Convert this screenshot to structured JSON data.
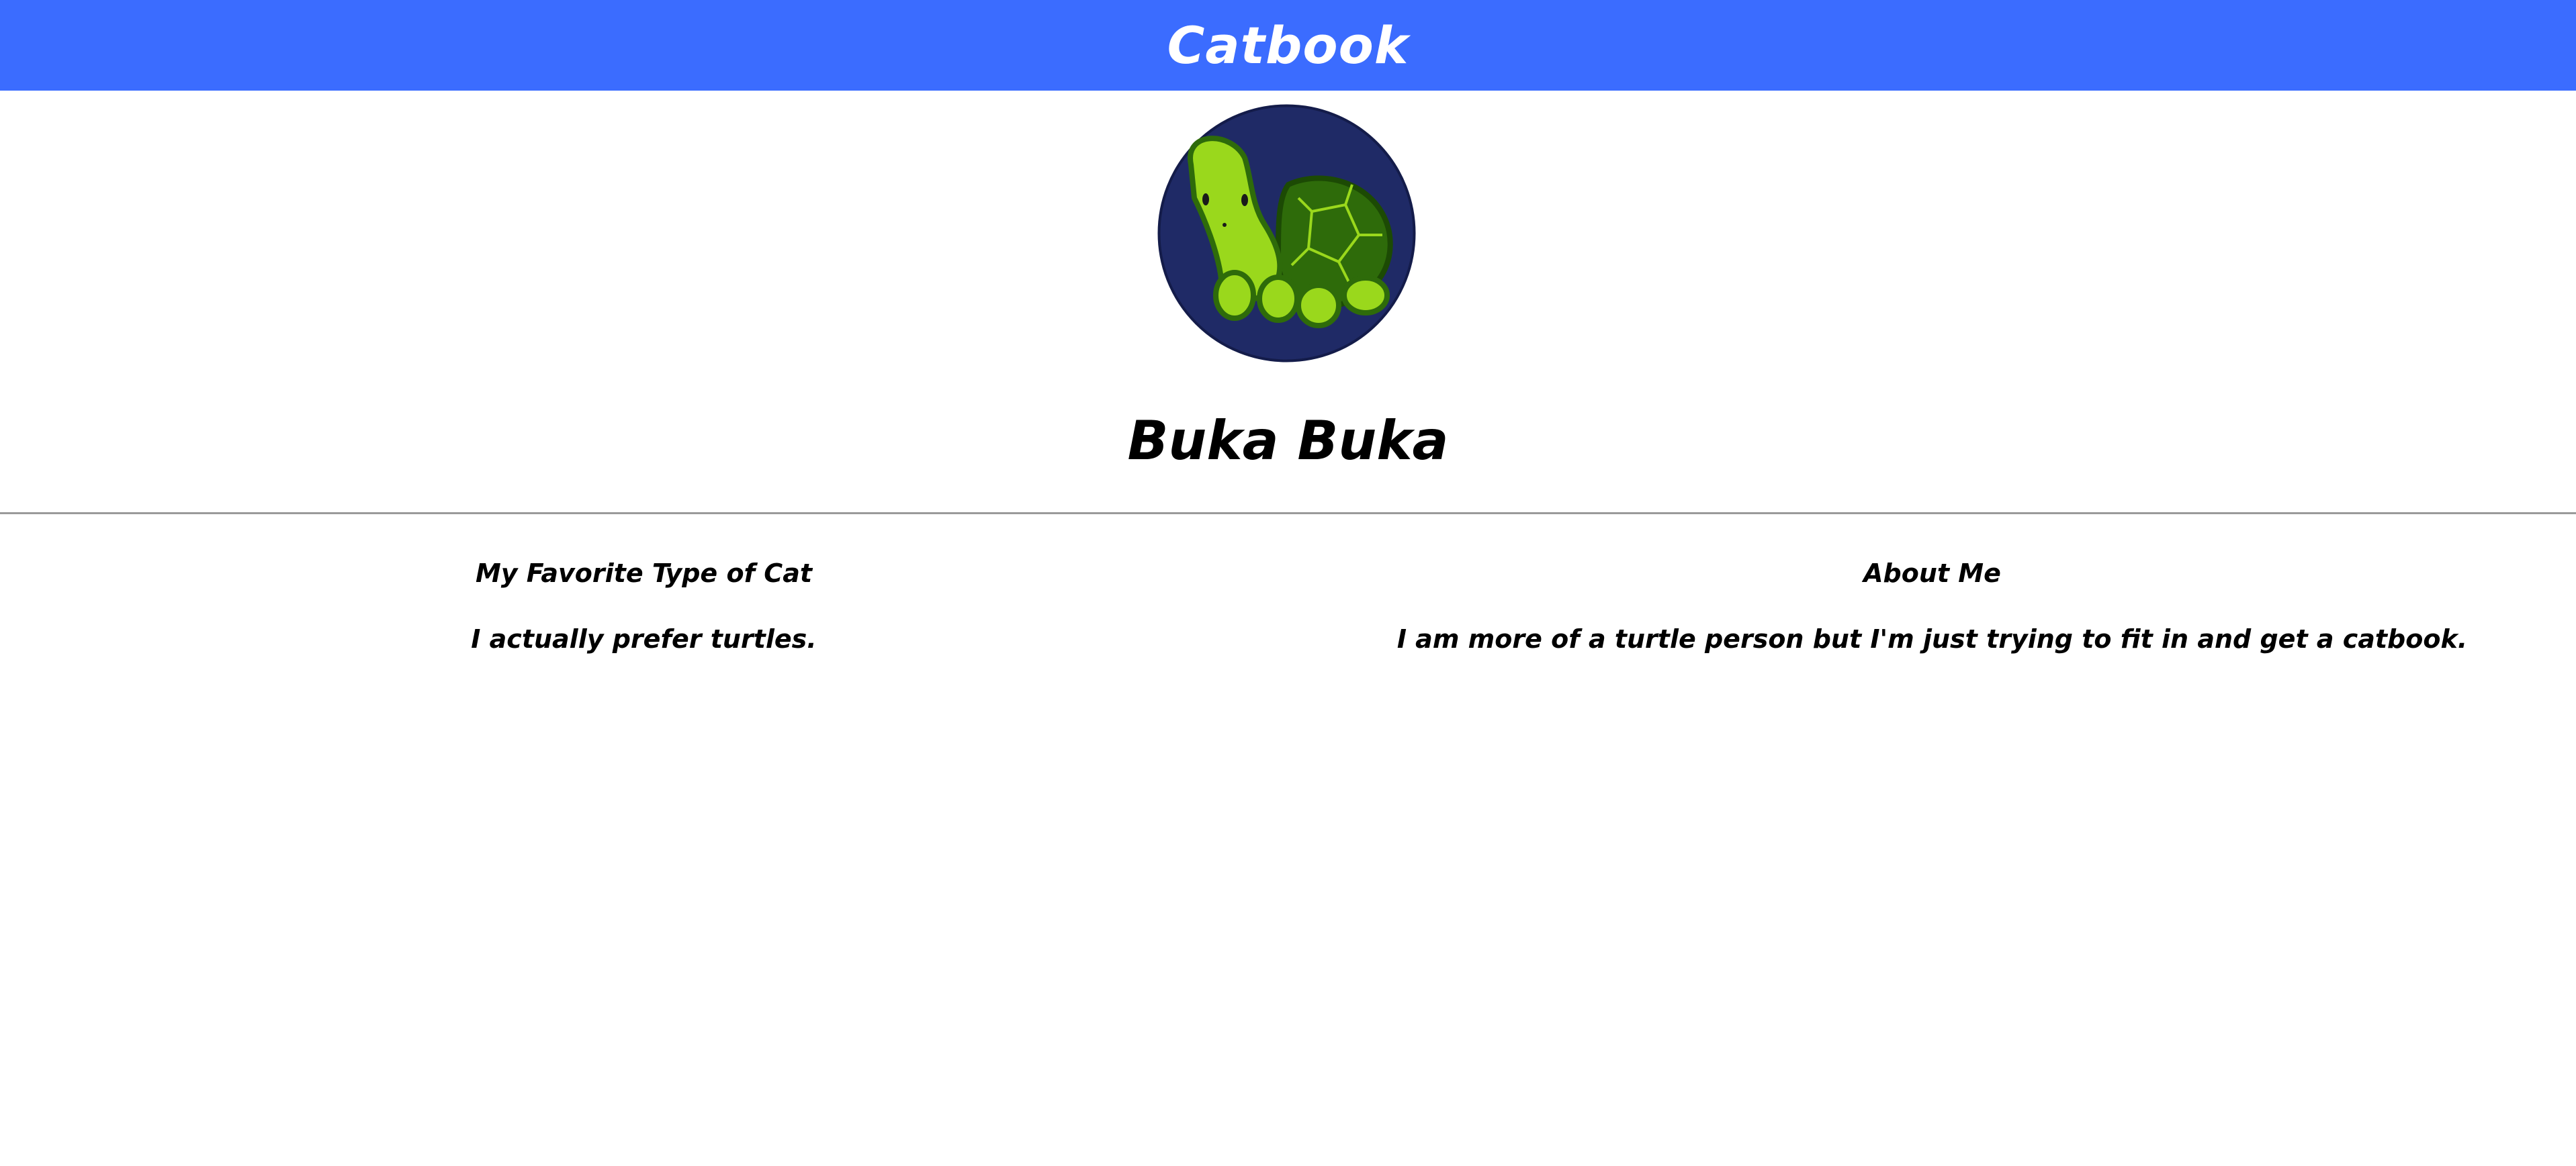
{
  "navbar": {
    "title": "Catbook",
    "background_color": "#3b6cff"
  },
  "profile": {
    "avatar_icon": "turtle-icon",
    "avatar_background": "#1f2a66",
    "name": "Buka Buka"
  },
  "sections": {
    "favorite_cat": {
      "heading": "My Favorite Type of Cat",
      "text": "I actually prefer turtles."
    },
    "about_me": {
      "heading": "About Me",
      "text": "I am more of a turtle person but I'm just trying to fit in and get a catbook."
    }
  }
}
